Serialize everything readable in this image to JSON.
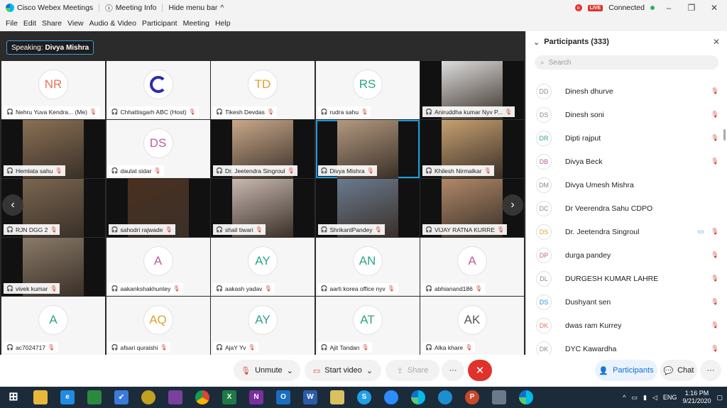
{
  "titlebar": {
    "app": "Cisco Webex Meetings",
    "meeting_info": "Meeting Info",
    "hide_menu": "Hide menu bar",
    "live": "LIVE",
    "record_dot": "o",
    "status": "Connected"
  },
  "menu": [
    "File",
    "Edit",
    "Share",
    "View",
    "Audio & Video",
    "Participant",
    "Meeting",
    "Help"
  ],
  "speaking": {
    "label": "Speaking:",
    "name": "Divya Mishra"
  },
  "tiles": [
    {
      "name": "Nehru Yuva Kendra... (Me)",
      "initials": "NR",
      "color": "#e8735a",
      "video": false
    },
    {
      "name": "Chhattisgarh ABC (Host)",
      "initials": "",
      "color": "#2b2bb5",
      "video": false,
      "logo": true
    },
    {
      "name": "Tikesh Devdas",
      "initials": "TD",
      "color": "#e0a030",
      "video": false
    },
    {
      "name": "rudra sahu",
      "initials": "RS",
      "color": "#2aa58a",
      "video": false
    },
    {
      "name": "Aniruddha kumar Nyv P...",
      "initials": "",
      "color": "#ddd",
      "video": true
    },
    {
      "name": "Hemlata sahu",
      "initials": "",
      "color": "#8a7055",
      "video": true
    },
    {
      "name": "daulat sidar",
      "initials": "DS",
      "color": "#c05aa0",
      "video": false
    },
    {
      "name": "Dr. Jeetendra Singroul",
      "initials": "",
      "color": "#c9a88a",
      "video": true
    },
    {
      "name": "Divya Mishra",
      "initials": "",
      "color": "#b39980",
      "video": true
    },
    {
      "name": "Khilesh Nirmalkar",
      "initials": "",
      "color": "#c7a070",
      "video": true
    },
    {
      "name": "RJN DGG 2",
      "initials": "",
      "color": "#7a6650",
      "video": true
    },
    {
      "name": "sahodri rajwade",
      "initials": "",
      "color": "#4a3020",
      "video": true
    },
    {
      "name": "shail tiwari",
      "initials": "",
      "color": "#c8b8b0",
      "video": true
    },
    {
      "name": "ShrikantPandey",
      "initials": "",
      "color": "#6a7a90",
      "video": true
    },
    {
      "name": "VIJAY RATNA KURRE",
      "initials": "",
      "color": "#b08868",
      "video": true
    },
    {
      "name": "vivek kumar",
      "initials": "",
      "color": "#8a7a68",
      "video": true
    },
    {
      "name": "aakankshakhuntey",
      "initials": "A",
      "color": "#c05aa0",
      "video": false
    },
    {
      "name": "aakash yadav",
      "initials": "AY",
      "color": "#2aa58a",
      "video": false
    },
    {
      "name": "aarti korea office nyv",
      "initials": "AN",
      "color": "#2aa58a",
      "video": false
    },
    {
      "name": "abhianand186",
      "initials": "A",
      "color": "#c05aa0",
      "video": false
    },
    {
      "name": "ac7024717",
      "initials": "A",
      "color": "#2aa58a",
      "video": false
    },
    {
      "name": "afsari quraishi",
      "initials": "AQ",
      "color": "#e0a030",
      "video": false
    },
    {
      "name": "AjaY Yv",
      "initials": "AY",
      "color": "#2aa58a",
      "video": false
    },
    {
      "name": "Ajit Tandan",
      "initials": "AT",
      "color": "#2aa58a",
      "video": false
    },
    {
      "name": "Alka khare",
      "initials": "AK",
      "color": "#555555",
      "video": false
    }
  ],
  "participants_panel": {
    "title": "Participants (333)",
    "search_placeholder": "Search",
    "rows": [
      {
        "initials": "DD",
        "name": "Dinesh dhurve",
        "color": "#888888",
        "mic": true,
        "cam": false
      },
      {
        "initials": "DS",
        "name": "Dinesh soni",
        "color": "#888888",
        "mic": true,
        "cam": false
      },
      {
        "initials": "DR",
        "name": "Dipti rajput",
        "color": "#2aa58a",
        "mic": true,
        "cam": false
      },
      {
        "initials": "DB",
        "name": "Divya Beck",
        "color": "#c05aa0",
        "mic": true,
        "cam": false
      },
      {
        "initials": "DM",
        "name": "Divya Umesh Mishra",
        "color": "#888888",
        "mic": false,
        "cam": false
      },
      {
        "initials": "DC",
        "name": "Dr Veerendra Sahu CDPO",
        "color": "#888888",
        "mic": false,
        "cam": false
      },
      {
        "initials": "DS",
        "name": "Dr. Jeetendra Singroul",
        "color": "#e0a030",
        "mic": true,
        "cam": true
      },
      {
        "initials": "DP",
        "name": "durga pandey",
        "color": "#c05aa0",
        "mic": true,
        "cam": false
      },
      {
        "initials": "DL",
        "name": "DURGESH KUMAR LAHRE",
        "color": "#888888",
        "mic": true,
        "cam": false
      },
      {
        "initials": "DS",
        "name": "Dushyant sen",
        "color": "#1a9ce0",
        "mic": true,
        "cam": false
      },
      {
        "initials": "DK",
        "name": "dwas ram Kurrey",
        "color": "#e8735a",
        "mic": true,
        "cam": false
      },
      {
        "initials": "DK",
        "name": "DYC Kawardha",
        "color": "#888888",
        "mic": true,
        "cam": false
      }
    ]
  },
  "controls": {
    "unmute": "Unmute",
    "start_video": "Start video",
    "share": "Share",
    "more": "···",
    "participants": "Participants",
    "chat": "Chat"
  },
  "taskbar": {
    "lang": "ENG",
    "time": "1:16 PM",
    "date": "9/21/2020"
  }
}
